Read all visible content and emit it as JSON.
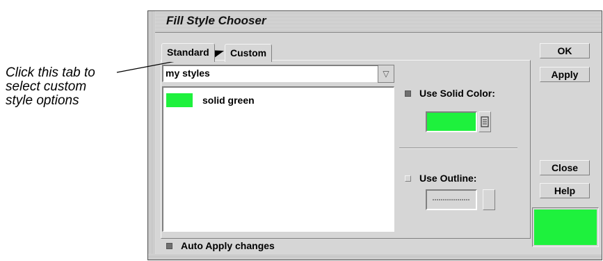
{
  "annotation": {
    "lines": [
      "Click this tab to",
      "select custom",
      "style options"
    ]
  },
  "window": {
    "title": "Fill Style Chooser",
    "tabs": [
      {
        "label": "Standard",
        "selected": true
      },
      {
        "label": "Custom",
        "selected": false
      }
    ],
    "style_set": {
      "value": "my styles"
    },
    "styles_list": [
      {
        "name": "solid green",
        "color": "#1ef13d"
      }
    ],
    "use_solid_color": {
      "label": "Use Solid Color:",
      "checked": true,
      "color": "#1ef13d"
    },
    "use_outline": {
      "label": "Use Outline:",
      "checked": false
    },
    "auto_apply": {
      "label": "Auto Apply changes",
      "checked": true
    },
    "buttons": {
      "ok": "OK",
      "apply": "Apply",
      "close": "Close",
      "help": "Help"
    },
    "preview_color": "#1ef13d"
  },
  "colors": {
    "window_bg": "#d6d6d6",
    "accent_green": "#1ef13d"
  }
}
